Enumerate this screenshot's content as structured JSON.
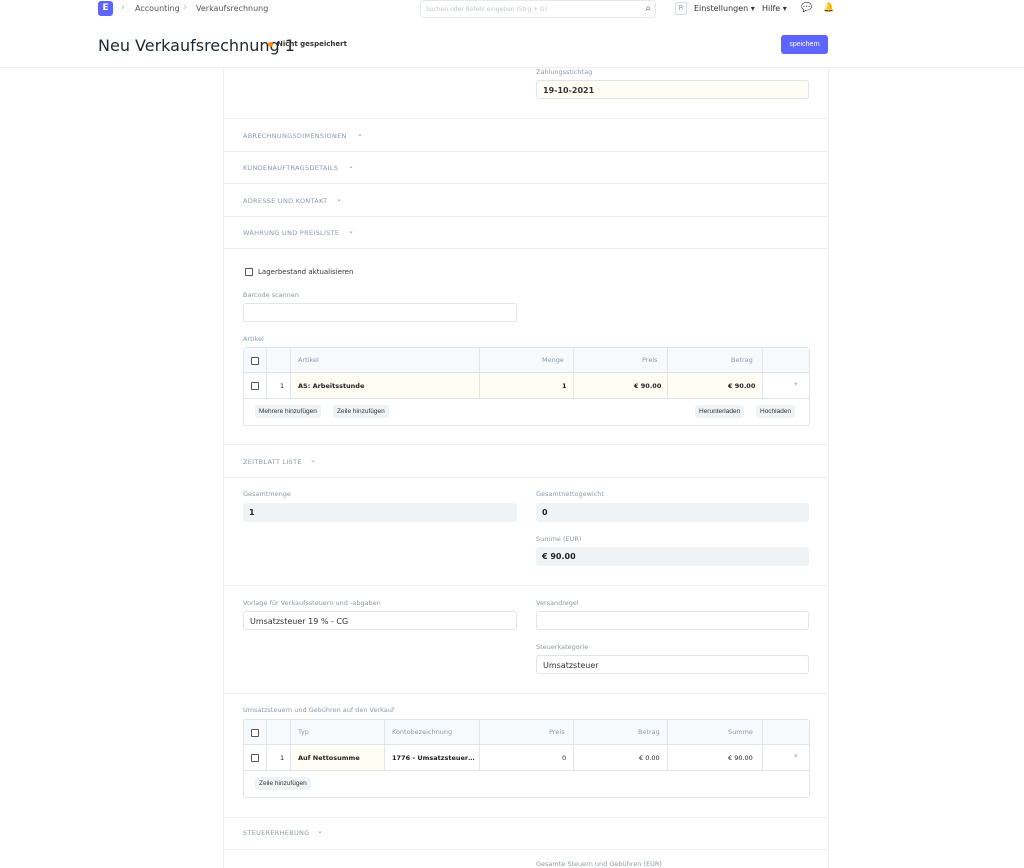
{
  "navbar": {
    "logo_letter": "E",
    "breadcrumbs": [
      "Accounting",
      "Verkaufsrechnung"
    ],
    "search_placeholder": "Suchen oder Befehl eingeben (Strg + G)",
    "avatar_letter": "R",
    "settings_label": "Einstellungen",
    "help_label": "Hilfe"
  },
  "page": {
    "title": "Neu Verkaufsrechnung 1",
    "status": "Nicht gespeichert",
    "save_label": "speichern"
  },
  "form": {
    "payment_due_label": "Zahlungsstichtag",
    "payment_due_value": "19-10-2021",
    "sections": {
      "accounting_dimensions": "ABRECHNUNGSDIMENSIONEN",
      "sales_order_details": "KUNDENAUFTRAGSDETAILS",
      "address_contact": "ADRESSE UND KONTAKT",
      "currency_pricelist": "WÄHRUNG UND PREISLISTE",
      "timesheet_list": "ZEITBLATT LISTE",
      "tax_collection": "STEUERERHEBUNG"
    },
    "update_stock_label": "Lagerbestand aktualisieren",
    "barcode_label": "Barcode scannen",
    "barcode_value": "",
    "items_label": "Artikel",
    "items_grid": {
      "columns": [
        "Artikel",
        "Menge",
        "Preis",
        "Betrag"
      ],
      "rows": [
        {
          "idx": "1",
          "item": "AS: Arbeitsstunde",
          "qty": "1",
          "rate": "€ 90.00",
          "amount": "€ 90.00"
        }
      ],
      "buttons": {
        "add_multiple": "Mehrere hinzufügen",
        "add_row": "Zeile hinzufügen",
        "download": "Herunterladen",
        "upload": "Hochladen"
      }
    },
    "total_qty_label": "Gesamtmenge",
    "total_qty_value": "1",
    "total_net_weight_label": "Gesamtnettogewicht",
    "total_net_weight_value": "0",
    "total_label": "Summe (EUR)",
    "total_value": "€ 90.00",
    "tax_template_label": "Vorlage für Verkaufssteuern und -abgaben",
    "tax_template_value": "Umsatzsteuer 19 % - CG",
    "shipping_rule_label": "Versandregel",
    "shipping_rule_value": "",
    "tax_category_label": "Steuerkategorie",
    "tax_category_value": "Umsatzsteuer",
    "taxes_label": "Umsatzsteuern und Gebühren auf den Verkauf",
    "taxes_grid": {
      "columns": [
        "Typ",
        "Kontobezeichnung",
        "Preis",
        "Betrag",
        "Summe"
      ],
      "rows": [
        {
          "idx": "1",
          "type": "Auf Nettosumme",
          "account": "1776 - Umsatzsteuer…",
          "rate": "0",
          "amount": "€ 0.00",
          "total": "€ 90.00"
        }
      ],
      "add_row": "Zeile hinzufügen"
    },
    "total_taxes_label": "Gesamte Steuern und Gebühren (EUR)"
  }
}
